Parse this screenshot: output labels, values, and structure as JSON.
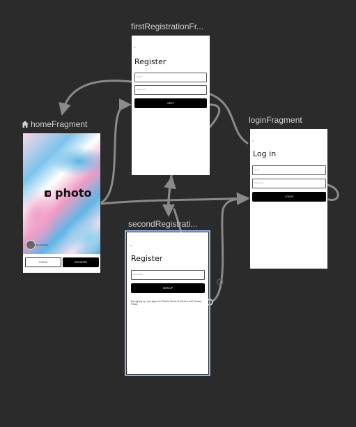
{
  "home": {
    "label": "homeFragment",
    "icon": "home-icon",
    "logo_text": "photo",
    "author": "@artsbyjuliett",
    "login_label": "LOG IN",
    "register_label": "REGISTER"
  },
  "first_registration": {
    "label": "firstRegistrationFr...",
    "back": "<",
    "title": "Register",
    "email_placeholder": "Email",
    "password_placeholder": "Password",
    "next_label": "NEXT"
  },
  "login": {
    "label": "loginFragment",
    "back": "<",
    "title": "Log in",
    "email_placeholder": "Email",
    "password_placeholder": "Password",
    "login_label": "LOG IN"
  },
  "second_registration": {
    "label": "secondRegistrati...",
    "back": "<",
    "title": "Register",
    "username_placeholder": "Username",
    "signup_label": "SIGN UP",
    "terms": "By signing up, you agree to Photo's Terms of Service and Privacy Policy."
  },
  "colors": {
    "background": "#2b2b2b",
    "arrow": "#8a8a8a",
    "selection": "#8fb4e8"
  }
}
